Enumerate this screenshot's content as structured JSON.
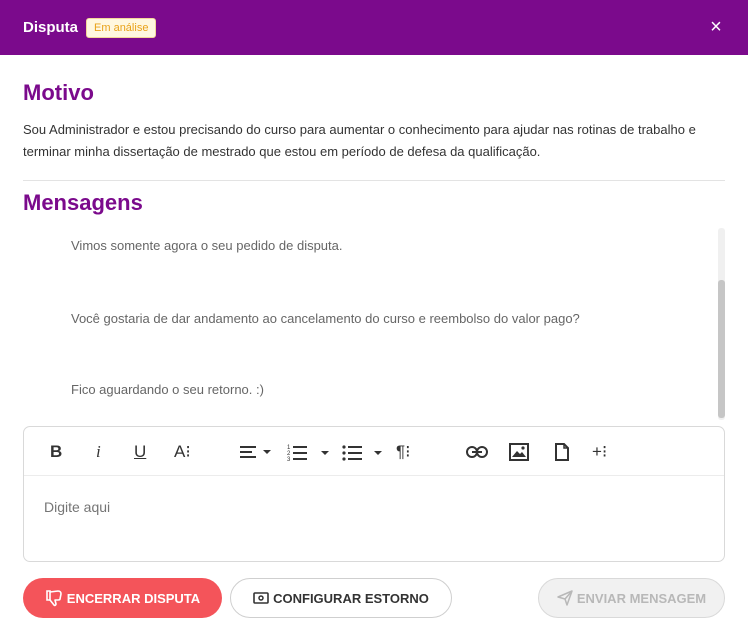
{
  "header": {
    "title": "Disputa",
    "status": "Em análise",
    "close_icon": "close-icon",
    "close_glyph": "×",
    "background": "#7b0a8c"
  },
  "motivo": {
    "title": "Motivo",
    "text": "Sou Administrador e estou precisando do curso para aumentar o conhecimento para ajudar nas rotinas de trabalho e terminar minha dissertação de mestrado que estou em período de defesa da qualificação."
  },
  "mensagens": {
    "title": "Mensagens",
    "items": [
      "Vimos somente agora o seu pedido de disputa.",
      "Você gostaria de dar andamento ao cancelamento do curso e reembolso do valor pago?",
      "Fico aguardando o seu retorno. :)"
    ]
  },
  "editor": {
    "placeholder": "Digite aqui",
    "toolbar": {
      "bold": "B",
      "italic": "i",
      "underline": "U",
      "font_size": "A⁝",
      "paragraph": "¶⁝",
      "insert_more": "+⁝",
      "icons": [
        "bold-icon",
        "italic-icon",
        "underline-icon",
        "font-size-icon",
        "align-icon",
        "ordered-list-icon",
        "unordered-list-icon",
        "paragraph-format-icon",
        "link-icon",
        "image-icon",
        "file-icon",
        "insert-more-icon"
      ]
    }
  },
  "actions": {
    "close_dispute": "ENCERRAR DISPUTA",
    "configure_refund": "CONFIGURAR ESTORNO",
    "send_message": "ENVIAR MENSAGEM",
    "close_dispute_color": "#f4545a"
  }
}
